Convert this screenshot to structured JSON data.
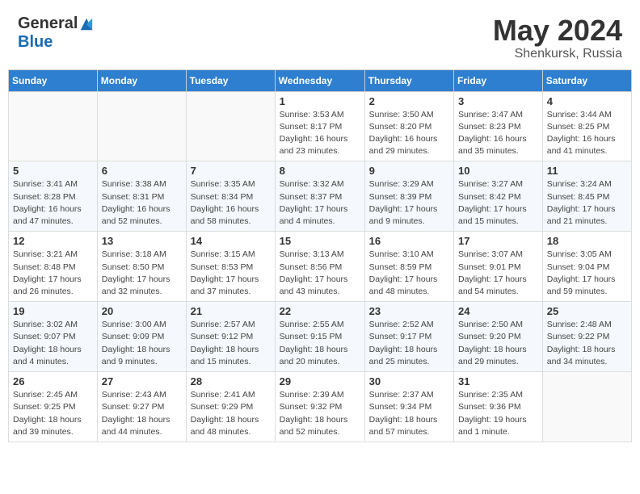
{
  "header": {
    "logo_general": "General",
    "logo_blue": "Blue",
    "month": "May 2024",
    "location": "Shenkursk, Russia"
  },
  "days_of_week": [
    "Sunday",
    "Monday",
    "Tuesday",
    "Wednesday",
    "Thursday",
    "Friday",
    "Saturday"
  ],
  "weeks": [
    [
      {
        "day": "",
        "info": ""
      },
      {
        "day": "",
        "info": ""
      },
      {
        "day": "",
        "info": ""
      },
      {
        "day": "1",
        "info": "Sunrise: 3:53 AM\nSunset: 8:17 PM\nDaylight: 16 hours\nand 23 minutes."
      },
      {
        "day": "2",
        "info": "Sunrise: 3:50 AM\nSunset: 8:20 PM\nDaylight: 16 hours\nand 29 minutes."
      },
      {
        "day": "3",
        "info": "Sunrise: 3:47 AM\nSunset: 8:23 PM\nDaylight: 16 hours\nand 35 minutes."
      },
      {
        "day": "4",
        "info": "Sunrise: 3:44 AM\nSunset: 8:25 PM\nDaylight: 16 hours\nand 41 minutes."
      }
    ],
    [
      {
        "day": "5",
        "info": "Sunrise: 3:41 AM\nSunset: 8:28 PM\nDaylight: 16 hours\nand 47 minutes."
      },
      {
        "day": "6",
        "info": "Sunrise: 3:38 AM\nSunset: 8:31 PM\nDaylight: 16 hours\nand 52 minutes."
      },
      {
        "day": "7",
        "info": "Sunrise: 3:35 AM\nSunset: 8:34 PM\nDaylight: 16 hours\nand 58 minutes."
      },
      {
        "day": "8",
        "info": "Sunrise: 3:32 AM\nSunset: 8:37 PM\nDaylight: 17 hours\nand 4 minutes."
      },
      {
        "day": "9",
        "info": "Sunrise: 3:29 AM\nSunset: 8:39 PM\nDaylight: 17 hours\nand 9 minutes."
      },
      {
        "day": "10",
        "info": "Sunrise: 3:27 AM\nSunset: 8:42 PM\nDaylight: 17 hours\nand 15 minutes."
      },
      {
        "day": "11",
        "info": "Sunrise: 3:24 AM\nSunset: 8:45 PM\nDaylight: 17 hours\nand 21 minutes."
      }
    ],
    [
      {
        "day": "12",
        "info": "Sunrise: 3:21 AM\nSunset: 8:48 PM\nDaylight: 17 hours\nand 26 minutes."
      },
      {
        "day": "13",
        "info": "Sunrise: 3:18 AM\nSunset: 8:50 PM\nDaylight: 17 hours\nand 32 minutes."
      },
      {
        "day": "14",
        "info": "Sunrise: 3:15 AM\nSunset: 8:53 PM\nDaylight: 17 hours\nand 37 minutes."
      },
      {
        "day": "15",
        "info": "Sunrise: 3:13 AM\nSunset: 8:56 PM\nDaylight: 17 hours\nand 43 minutes."
      },
      {
        "day": "16",
        "info": "Sunrise: 3:10 AM\nSunset: 8:59 PM\nDaylight: 17 hours\nand 48 minutes."
      },
      {
        "day": "17",
        "info": "Sunrise: 3:07 AM\nSunset: 9:01 PM\nDaylight: 17 hours\nand 54 minutes."
      },
      {
        "day": "18",
        "info": "Sunrise: 3:05 AM\nSunset: 9:04 PM\nDaylight: 17 hours\nand 59 minutes."
      }
    ],
    [
      {
        "day": "19",
        "info": "Sunrise: 3:02 AM\nSunset: 9:07 PM\nDaylight: 18 hours\nand 4 minutes."
      },
      {
        "day": "20",
        "info": "Sunrise: 3:00 AM\nSunset: 9:09 PM\nDaylight: 18 hours\nand 9 minutes."
      },
      {
        "day": "21",
        "info": "Sunrise: 2:57 AM\nSunset: 9:12 PM\nDaylight: 18 hours\nand 15 minutes."
      },
      {
        "day": "22",
        "info": "Sunrise: 2:55 AM\nSunset: 9:15 PM\nDaylight: 18 hours\nand 20 minutes."
      },
      {
        "day": "23",
        "info": "Sunrise: 2:52 AM\nSunset: 9:17 PM\nDaylight: 18 hours\nand 25 minutes."
      },
      {
        "day": "24",
        "info": "Sunrise: 2:50 AM\nSunset: 9:20 PM\nDaylight: 18 hours\nand 29 minutes."
      },
      {
        "day": "25",
        "info": "Sunrise: 2:48 AM\nSunset: 9:22 PM\nDaylight: 18 hours\nand 34 minutes."
      }
    ],
    [
      {
        "day": "26",
        "info": "Sunrise: 2:45 AM\nSunset: 9:25 PM\nDaylight: 18 hours\nand 39 minutes."
      },
      {
        "day": "27",
        "info": "Sunrise: 2:43 AM\nSunset: 9:27 PM\nDaylight: 18 hours\nand 44 minutes."
      },
      {
        "day": "28",
        "info": "Sunrise: 2:41 AM\nSunset: 9:29 PM\nDaylight: 18 hours\nand 48 minutes."
      },
      {
        "day": "29",
        "info": "Sunrise: 2:39 AM\nSunset: 9:32 PM\nDaylight: 18 hours\nand 52 minutes."
      },
      {
        "day": "30",
        "info": "Sunrise: 2:37 AM\nSunset: 9:34 PM\nDaylight: 18 hours\nand 57 minutes."
      },
      {
        "day": "31",
        "info": "Sunrise: 2:35 AM\nSunset: 9:36 PM\nDaylight: 19 hours\nand 1 minute."
      },
      {
        "day": "",
        "info": ""
      }
    ]
  ]
}
